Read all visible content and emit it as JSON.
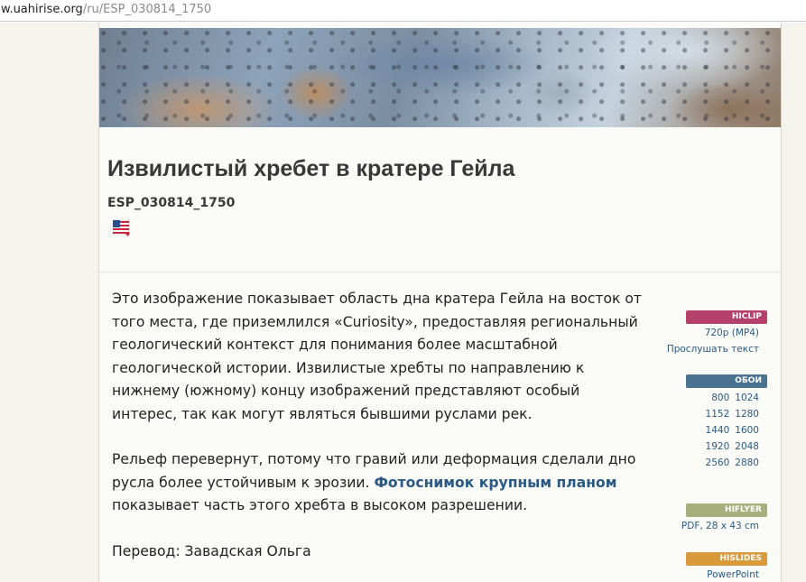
{
  "address_bar": {
    "host": "w.uahirise.org",
    "path": "/ru/ESP_030814_1750"
  },
  "page": {
    "title": "Извилистый хребет в кратере Гейла",
    "image_id": "ESP_030814_1750",
    "flag_icon": "us-flag-icon"
  },
  "body": {
    "p1": "Это изображение показывает область дна кратера Гейла на восток от того места, где приземлился «Curiosity», предоставляя региональный геологический контекст для понимания более масштабной геологической истории. Извилистые хребты по направлению к нижнему (южному) концу изображений представляют особый интерес, так как могут являться бывшими руслами рек.",
    "p2_before": "Рельеф перевернут, потому что гравий или деформация сделали дно русла более устойчивым к эрозии. ",
    "p2_link": "Фотоснимок крупным планом",
    "p2_after": " показывает часть этого хребта в высоком разрешении.",
    "p3": "Перевод: Завадская Ольга"
  },
  "sidebar": {
    "hiclip": {
      "label": "HICLIP",
      "color": "#b5416b",
      "link": "720p (MP4)"
    },
    "listen": "Прослушать текст",
    "wallpapers": {
      "label": "ОБОИ",
      "color": "#4a7391",
      "rows": [
        [
          "800",
          "1024"
        ],
        [
          "1152",
          "1280"
        ],
        [
          "1440",
          "1600"
        ],
        [
          "1920",
          "2048"
        ],
        [
          "2560",
          "2880"
        ]
      ]
    },
    "hiflyer": {
      "label": "HIFLYER",
      "color": "#a7b07c",
      "link": "PDF, 28 x 43 cm"
    },
    "hislides": {
      "label": "HISLIDES",
      "color": "#d99a3c",
      "link": "PowerPoint"
    }
  }
}
